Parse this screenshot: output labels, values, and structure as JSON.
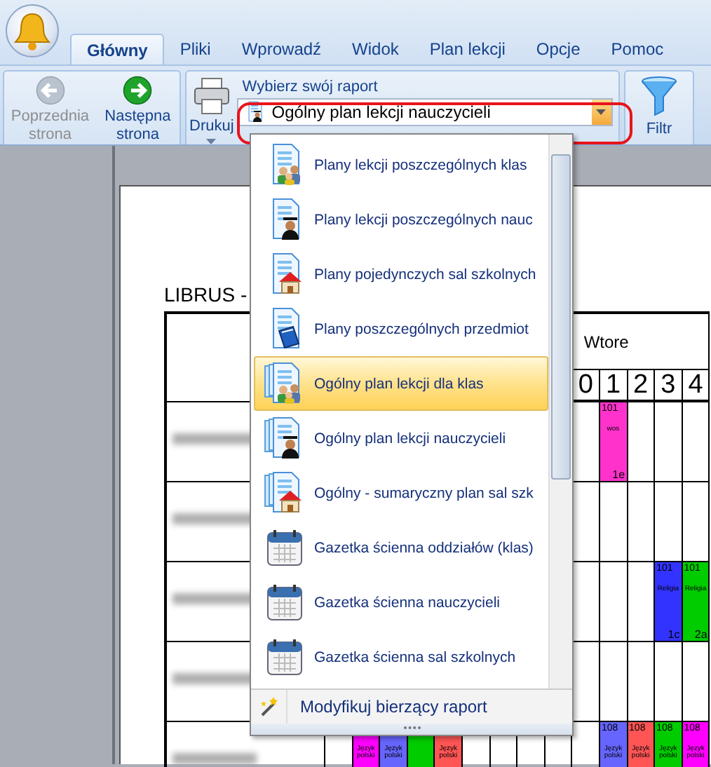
{
  "tabs": [
    {
      "label": "Główny",
      "selected": true
    },
    {
      "label": "Pliki",
      "selected": false
    },
    {
      "label": "Wprowadź",
      "selected": false
    },
    {
      "label": "Widok",
      "selected": false
    },
    {
      "label": "Plan lekcji",
      "selected": false
    },
    {
      "label": "Opcje",
      "selected": false
    },
    {
      "label": "Pomoc",
      "selected": false
    }
  ],
  "ribbon": {
    "nav": [
      {
        "label": "Poprzednia strona",
        "kind": "back",
        "disabled": true
      },
      {
        "label": "Następna strona",
        "kind": "forward",
        "disabled": false
      }
    ],
    "print": {
      "label": "Drukuj"
    },
    "report_label": "Wybierz swój raport",
    "report_combo": {
      "value": "Ogólny plan lekcji nauczycieli",
      "kind": "teacher"
    },
    "filter": {
      "label": "Filtr"
    }
  },
  "dropdown": {
    "items": [
      {
        "label": "Plany lekcji poszczególnych klas",
        "kind": "class",
        "selected": false
      },
      {
        "label": "Plany lekcji poszczególnych nauc",
        "kind": "teacher",
        "selected": false
      },
      {
        "label": "Plany pojedynczych sal szkolnych",
        "kind": "room",
        "selected": false
      },
      {
        "label": "Plany poszczególnych przedmiot",
        "kind": "subject",
        "selected": false
      },
      {
        "label": "Ogólny plan lekcji dla klas",
        "kind": "class-stack",
        "selected": true
      },
      {
        "label": "Ogólny plan lekcji nauczycieli",
        "kind": "teacher-stack",
        "selected": false
      },
      {
        "label": "Ogólny - sumaryczny plan sal szk",
        "kind": "room-stack",
        "selected": false
      },
      {
        "label": "Gazetka ścienna oddziałów (klas)",
        "kind": "calendar",
        "selected": false
      },
      {
        "label": "Gazetka ścienna nauczycieli",
        "kind": "calendar",
        "selected": false
      },
      {
        "label": "Gazetka ścienna sal szkolnych",
        "kind": "calendar",
        "selected": false
      }
    ],
    "footer": {
      "label": "Modyfikuj bierzący raport"
    }
  },
  "document": {
    "title": "LIBRUS -",
    "day_label": "Wtore",
    "hours": [
      "0",
      "1",
      "2",
      "3",
      "4"
    ],
    "rows": [
      {
        "slots": [
          {
            "kind": "empty"
          },
          {
            "kind": "empty"
          },
          {
            "kind": "empty"
          },
          {
            "kind": "empty"
          },
          {
            "kind": "empty"
          },
          {
            "kind": "empty"
          },
          {
            "kind": "empty"
          },
          {
            "kind": "empty"
          },
          {
            "kind": "empty"
          },
          {
            "kind": "empty"
          },
          {
            "kind": "lesson",
            "room": "101",
            "subject": "wos",
            "class": "1e",
            "color": "#ff33cc"
          }
        ]
      },
      {
        "slots": []
      },
      {
        "slots": [
          {
            "kind": "empty"
          },
          {
            "kind": "empty"
          },
          {
            "kind": "empty"
          },
          {
            "kind": "empty"
          },
          {
            "kind": "empty"
          },
          {
            "kind": "empty"
          },
          {
            "kind": "empty"
          },
          {
            "kind": "empty"
          },
          {
            "kind": "empty"
          },
          {
            "kind": "empty"
          },
          {
            "kind": "empty"
          },
          {
            "kind": "empty"
          },
          {
            "kind": "lesson",
            "room": "101",
            "subject": "Religia",
            "class": "1c",
            "color": "#3333ff"
          },
          {
            "kind": "lesson",
            "room": "101",
            "subject": "Religia",
            "class": "2a",
            "color": "#00cc00"
          }
        ]
      },
      {
        "slots": []
      },
      {
        "slots": [
          {
            "kind": "empty"
          },
          {
            "kind": "lesson",
            "subject": "Język polski",
            "color": "#ff00ff"
          },
          {
            "kind": "lesson",
            "subject": "Język polski",
            "color": "#6666ff"
          },
          {
            "kind": "lesson",
            "color": "#00cc00"
          },
          {
            "kind": "lesson",
            "subject": "Język polski",
            "color": "#ff5555"
          },
          {
            "kind": "empty"
          },
          {
            "kind": "empty"
          },
          {
            "kind": "empty"
          },
          {
            "kind": "empty"
          },
          {
            "kind": "empty"
          },
          {
            "kind": "lesson",
            "room": "108",
            "subject": "Język polski",
            "color": "#6666ff"
          },
          {
            "kind": "lesson",
            "room": "108",
            "subject": "Język polski",
            "color": "#ff5555"
          },
          {
            "kind": "lesson",
            "room": "108",
            "subject": "Język polski",
            "color": "#00cc00"
          },
          {
            "kind": "lesson",
            "room": "108",
            "subject": "Język polski",
            "color": "#ff00ff"
          }
        ]
      }
    ]
  }
}
